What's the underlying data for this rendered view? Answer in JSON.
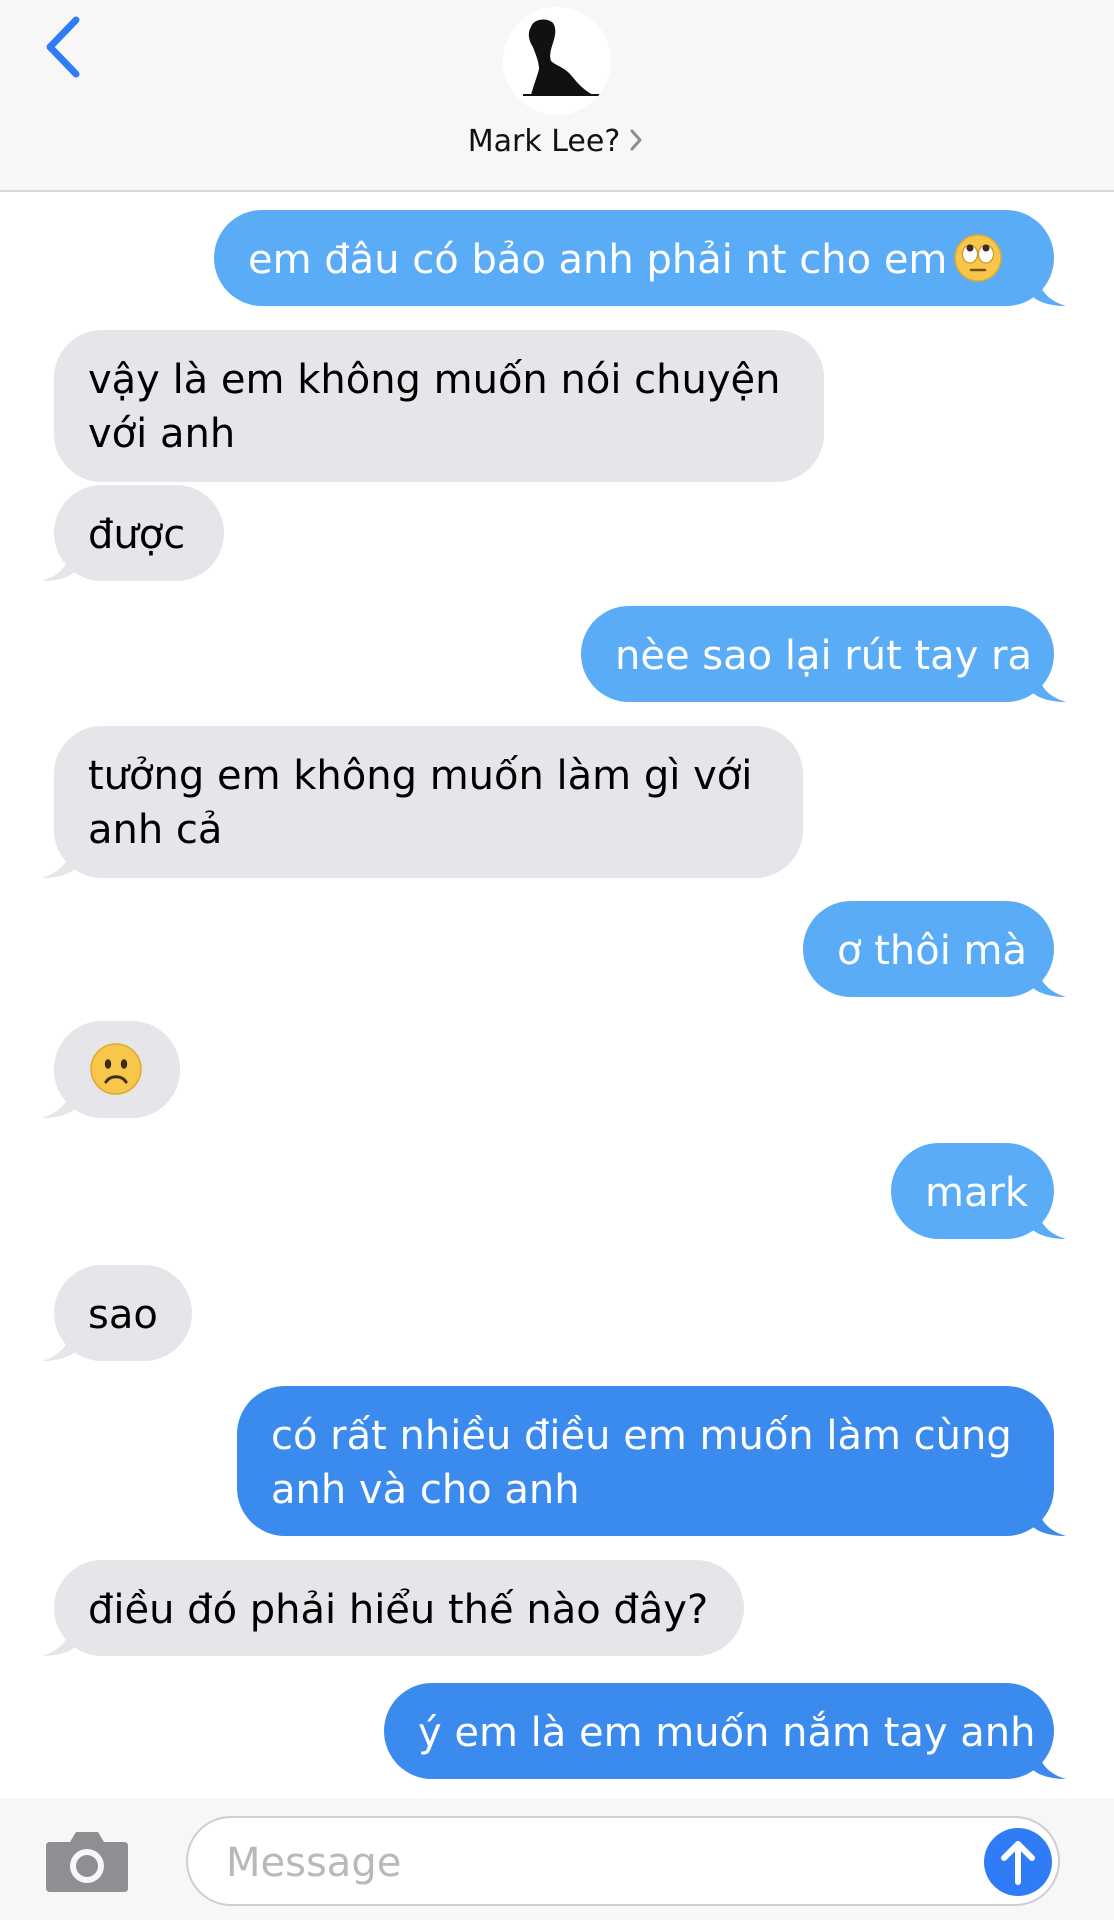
{
  "header": {
    "contact_name": "Mark Lee?",
    "back_icon": "chevron-left-icon",
    "disclosure_icon": "chevron-right-icon"
  },
  "colors": {
    "sent_bubble": "#5aacf7",
    "sent_bubble_latest": "#3b8bef",
    "received_bubble": "#e5e5ea",
    "accent": "#2f7cf6"
  },
  "messages": [
    {
      "direction": "sent",
      "text": "em đâu có bảo anh phải nt cho em",
      "emoji": "face-with-rolling-eyes"
    },
    {
      "direction": "received",
      "lines": [
        "vậy là em không muốn nói chuyện",
        "với anh"
      ]
    },
    {
      "direction": "received",
      "text": "được"
    },
    {
      "direction": "sent",
      "text": "nèe sao lại rút tay ra"
    },
    {
      "direction": "received",
      "lines": [
        "tưởng em không muốn làm gì với",
        "anh cả"
      ]
    },
    {
      "direction": "sent",
      "text": "ơ thôi mà"
    },
    {
      "direction": "received",
      "emoji": "frowning-face"
    },
    {
      "direction": "sent",
      "text": "mark"
    },
    {
      "direction": "received",
      "text": "sao"
    },
    {
      "direction": "sent",
      "lines": [
        "có rất nhiều điều em muốn làm cùng",
        "anh và cho anh"
      ]
    },
    {
      "direction": "received",
      "text": "điều đó phải hiểu thế nào đây?"
    },
    {
      "direction": "sent",
      "text": "ý em là em muốn nắm tay anh"
    }
  ],
  "compose": {
    "placeholder": "Message",
    "camera_icon": "camera-icon",
    "send_icon": "arrow-up-icon"
  }
}
